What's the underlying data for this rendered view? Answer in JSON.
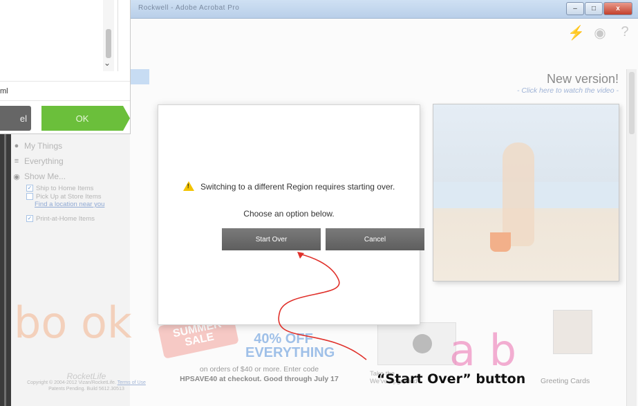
{
  "window": {
    "title": "Rockwell - Adobe Acrobat Pro",
    "minimize": "–",
    "maximize": "□",
    "close": "x"
  },
  "toolbar_icons": [
    "lightning-icon",
    "globe-icon",
    "help-icon"
  ],
  "toolbar_glyphs": {
    "lightning": "⚡",
    "globe": "◉",
    "help": "?"
  },
  "file_dialog": {
    "filename_fragment": "ml",
    "cancel_fragment": "el",
    "ok_label": "OK",
    "scroll_chevron": "⌄"
  },
  "sidebar": {
    "my_things": "My Things",
    "everything": "Everything",
    "show_me": "Show Me...",
    "options": [
      {
        "label": "Ship to Home Items",
        "checked": true
      },
      {
        "label": "Pick Up at Store Items",
        "checked": false
      },
      {
        "label": "Print-at-Home Items",
        "checked": true
      }
    ],
    "find_location": "Find a location near you"
  },
  "page": {
    "new_version_title": "New version!",
    "new_version_link": "- Click here to watch the video -",
    "sale_tag_lines": [
      "SUMMER",
      "SALE"
    ],
    "promo_percent": "40% OFF",
    "promo_everything": "EVERYTHING",
    "promo_line1": "on orders of $40 or more.  Enter code",
    "promo_line2": "HPSAVE40 at checkout.  Good through July 17",
    "video_caption_1": "Take the",
    "video_caption_2": "We've upgraded",
    "greeting_cards": "Greeting Cards",
    "footer_logo": "RocketLife",
    "footer_copyright": "Copyright © 2004-2012 Vizan/RocketLife.",
    "footer_terms": "Terms of Use",
    "footer_patents": "Patents Pending. Build 5612.30513"
  },
  "modal": {
    "message": "Switching to a different Region requires starting over.",
    "instruction": "Choose an option below.",
    "start_over_label": "Start Over",
    "cancel_label": "Cancel"
  },
  "annotation": {
    "label": "“Start Over” button",
    "color": "#e0302a"
  },
  "watermark": {
    "text_left": "bo ok",
    "text_right": "a b",
    "colors": [
      "#f3b48e",
      "#ec6fb0"
    ]
  }
}
